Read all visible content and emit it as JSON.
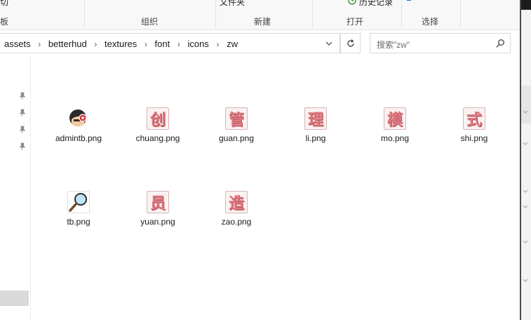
{
  "ribbon": {
    "top_left_fragment": "切",
    "top_fragment_new": "文件夹",
    "history_label": "历史记录",
    "groups": {
      "left_fragment": "板",
      "organize": "组织",
      "new": "新建",
      "open": "打开",
      "select": "选择"
    }
  },
  "address_bar": {
    "crumbs": [
      "assets",
      "betterhud",
      "textures",
      "font",
      "icons",
      "zw"
    ],
    "separator": "›"
  },
  "search": {
    "placeholder": "搜索\"zw\""
  },
  "files": [
    {
      "name": "admintb.png",
      "icon": "helmet-avatar-icon"
    },
    {
      "name": "chuang.png",
      "glyph": "创"
    },
    {
      "name": "guan.png",
      "glyph": "管"
    },
    {
      "name": "li.png",
      "glyph": "理"
    },
    {
      "name": "mo.png",
      "glyph": "模"
    },
    {
      "name": "shi.png",
      "glyph": "式"
    },
    {
      "name": "tb.png",
      "icon": "magnifier-icon"
    },
    {
      "name": "yuan.png",
      "glyph": "员"
    },
    {
      "name": "zao.png",
      "glyph": "造"
    }
  ],
  "colors": {
    "glyph_fill": "#e0787f",
    "glyph_shadow": "#a84b55",
    "accent": "#1e6ed0"
  }
}
